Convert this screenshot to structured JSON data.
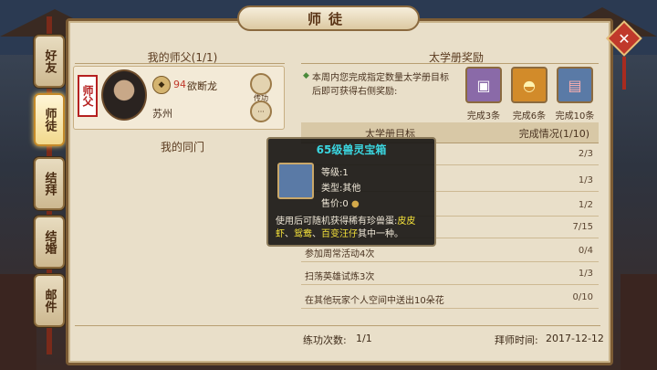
{
  "window": {
    "title": "师徒",
    "close_label": "✕"
  },
  "side_tabs": [
    {
      "label": "好友",
      "active": false
    },
    {
      "label": "师徒",
      "active": true
    },
    {
      "label": "结拜",
      "active": false
    },
    {
      "label": "结婚",
      "active": false
    },
    {
      "label": "邮件",
      "active": false
    }
  ],
  "master": {
    "section_title": "我的师父(1/1)",
    "tag": "师父",
    "level": "94",
    "name": "欲断龙",
    "location": "苏州",
    "train_button": "传功",
    "more_button": "···"
  },
  "peers": {
    "section_title": "我的同门"
  },
  "reward": {
    "section_title": "太学册奖励",
    "description": "本周内您完成指定数量太学册目标后即可获得右侧奖励:",
    "boxes": [
      {
        "label": "完成3条",
        "icon": "treasure-chest-icon",
        "color": "#8a6aa8"
      },
      {
        "label": "完成6条",
        "icon": "gold-ingot-icon",
        "color": "#d28b2a"
      },
      {
        "label": "完成10条",
        "icon": "gift-chest-icon",
        "color": "#5a7aa6"
      }
    ]
  },
  "table": {
    "col_goal": "太学册目标",
    "col_progress": "完成情况(1/10)",
    "rows": [
      {
        "task": "",
        "progress": "2/3"
      },
      {
        "task": "",
        "progress": "1/3"
      },
      {
        "task": "",
        "progress": "1/2"
      },
      {
        "task": "",
        "progress": "7/15"
      },
      {
        "task": "参加周常活动4次",
        "progress": "0/4"
      },
      {
        "task": "扫荡英雄试炼3次",
        "progress": "1/3"
      },
      {
        "task": "在其他玩家个人空间中送出10朵花",
        "progress": "0/10"
      }
    ]
  },
  "footer": {
    "train_count_label": "练功次数:",
    "train_count": "1/1",
    "master_time_label": "拜师时间:",
    "master_time": "2017-12-12"
  },
  "tooltip": {
    "title": "65级兽灵宝箱",
    "level_label": "等级:",
    "level": "1",
    "type_label": "类型:",
    "type": "其他",
    "price_label": "售价:",
    "price": "0",
    "desc_prefix": "使用后可随机获得稀有珍兽蛋:",
    "desc_highlight1": "皮皮虾",
    "desc_sep1": "、",
    "desc_highlight2": "鸳鸯",
    "desc_sep2": "、",
    "desc_highlight3": "百变汪仔",
    "desc_suffix": "其中一种。"
  }
}
